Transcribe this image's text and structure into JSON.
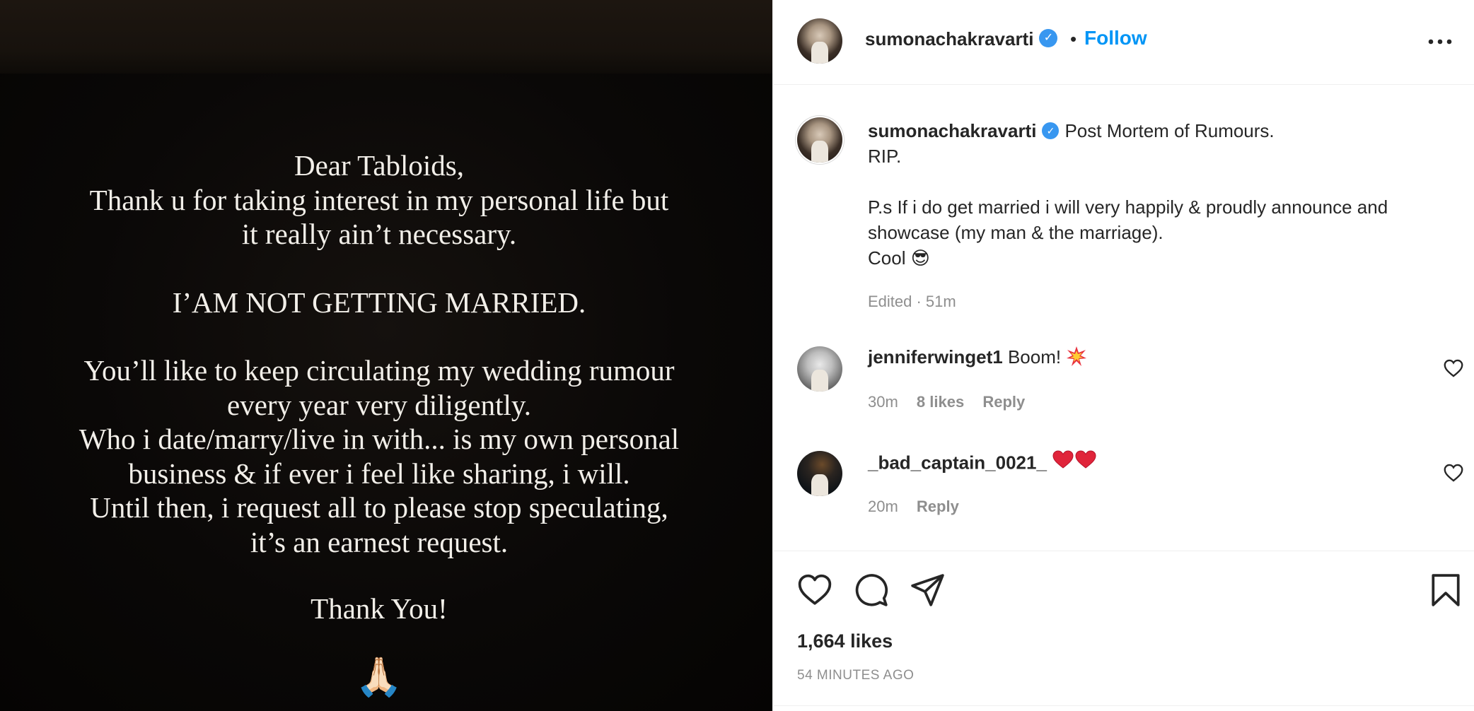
{
  "story": {
    "lines_block1": [
      "Dear Tabloids,",
      "Thank u for taking interest in my personal life but",
      "it really ain’t necessary."
    ],
    "line_block2": "I’AM NOT GETTING MARRIED.",
    "lines_block3": [
      "You’ll like to keep circulating my wedding rumour",
      "every year very diligently.",
      "Who i date/marry/live in with... is my own personal",
      "business & if ever i feel like sharing, i will.",
      "Until then, i request all to please stop speculating,",
      "it’s an earnest request."
    ],
    "line_block4": "Thank You!",
    "emoji": "🙏🏻"
  },
  "header": {
    "username": "sumonachakravarti",
    "separator": "•",
    "follow_label": "Follow",
    "more_label": "•••"
  },
  "caption": {
    "username": "sumonachakravarti",
    "text_first": "Post Mortem of Rumours.",
    "text_rest": "RIP.\n\nP.s If i do get married i will very happily & proudly announce and showcase (my man & the marriage).\nCool",
    "emoji": "😎",
    "meta": "Edited · 51m"
  },
  "comments": [
    {
      "username": "jenniferwinget1",
      "text": "Boom!",
      "emoji": "💥",
      "time": "30m",
      "likes": "8 likes",
      "reply": "Reply"
    },
    {
      "username": "_bad_captain_0021_",
      "text": "",
      "emoji": "❤❤",
      "time": "20m",
      "reply": "Reply"
    }
  ],
  "actions": {
    "like_icon": "heart-icon",
    "comment_icon": "comment-icon",
    "share_icon": "send-icon",
    "save_icon": "bookmark-icon",
    "likes_count": "1,664 likes",
    "posted_ago": "54 MINUTES AGO"
  },
  "colors": {
    "link": "#0095f6",
    "verified": "#3897f0",
    "muted": "#8e8e8e",
    "text": "#262626"
  }
}
